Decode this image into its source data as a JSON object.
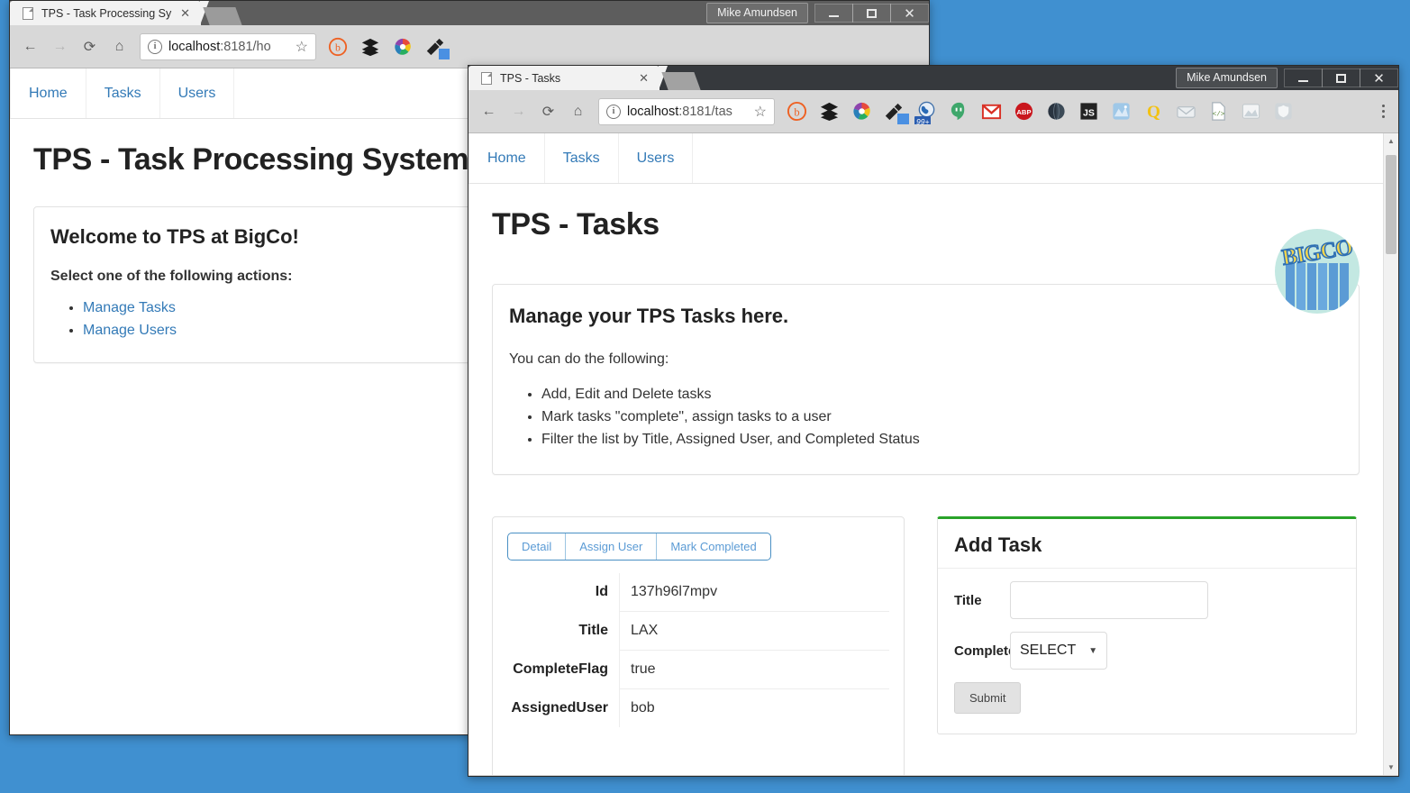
{
  "desktop": {
    "background_color": "#4090d0"
  },
  "window_back": {
    "titlebar": {
      "user": "Mike Amundsen",
      "minimize": "–",
      "maximize": "□",
      "close": "✕"
    },
    "tab": {
      "title": "TPS - Task Processing Sy",
      "close": "✕",
      "favicon": "page-icon"
    },
    "toolbar": {
      "back": "←",
      "forward": "→",
      "reload": "⟳",
      "home": "⌂",
      "info": "i",
      "url_host": "localhost",
      "url_rest": ":8181/ho",
      "star": "☆"
    },
    "nav": [
      {
        "label": "Home"
      },
      {
        "label": "Tasks"
      },
      {
        "label": "Users"
      }
    ],
    "page": {
      "title": "TPS - Task Processing System",
      "panel_heading": "Welcome to TPS at BigCo!",
      "panel_intro": "Select one of the following actions:",
      "links": [
        {
          "label": "Manage Tasks"
        },
        {
          "label": "Manage Users"
        }
      ]
    }
  },
  "window_front": {
    "titlebar": {
      "user": "Mike Amundsen",
      "minimize": "–",
      "maximize": "□",
      "close": "✕"
    },
    "tab": {
      "title": "TPS - Tasks",
      "close": "✕",
      "favicon": "page-icon"
    },
    "toolbar": {
      "back": "←",
      "forward": "→",
      "reload": "⟳",
      "home": "⌂",
      "info": "i",
      "url_host": "localhost",
      "url_rest": ":8181/tas",
      "star": "☆",
      "extensions": [
        "bitly-icon",
        "buffer-icon",
        "color-wheel-icon",
        "eyedropper-icon",
        "hangouts-dialer-icon",
        "hangouts-icon",
        "gmail-icon",
        "adblock-plus-icon",
        "dark-sphere-icon",
        "javascript-icon",
        "network-icon",
        "quora-icon",
        "envelope-icon",
        "code-file-icon",
        "image-icon",
        "shield-icon"
      ],
      "menu": "kebab-menu-icon"
    },
    "nav": [
      {
        "label": "Home"
      },
      {
        "label": "Tasks"
      },
      {
        "label": "Users"
      }
    ],
    "page": {
      "title": "TPS - Tasks",
      "logo": {
        "name": "bigco-logo",
        "word": "BIGCO"
      },
      "info_panel": {
        "heading": "Manage your TPS Tasks here.",
        "intro": "You can do the following:",
        "bullets": [
          "Add, Edit and Delete tasks",
          "Mark tasks \"complete\", assign tasks to a user",
          "Filter the list by Title, Assigned User, and Completed Status"
        ]
      },
      "detail_card": {
        "tabs": [
          {
            "label": "Detail"
          },
          {
            "label": "Assign User"
          },
          {
            "label": "Mark Completed"
          }
        ],
        "fields": [
          {
            "label": "Id",
            "value": "137h96l7mpv"
          },
          {
            "label": "Title",
            "value": "LAX"
          },
          {
            "label": "CompleteFlag",
            "value": "true"
          },
          {
            "label": "AssignedUser",
            "value": "bob"
          }
        ]
      },
      "add_task_form": {
        "accent_color": "#29a329",
        "title": "Add Task",
        "title_label": "Title",
        "title_value": "",
        "title_placeholder": "",
        "complete_label": "Complete",
        "complete_value": "SELECT",
        "caret": "▼",
        "submit_label": "Submit"
      }
    },
    "scrollbar": {
      "up": "▲",
      "down": "▼"
    }
  }
}
